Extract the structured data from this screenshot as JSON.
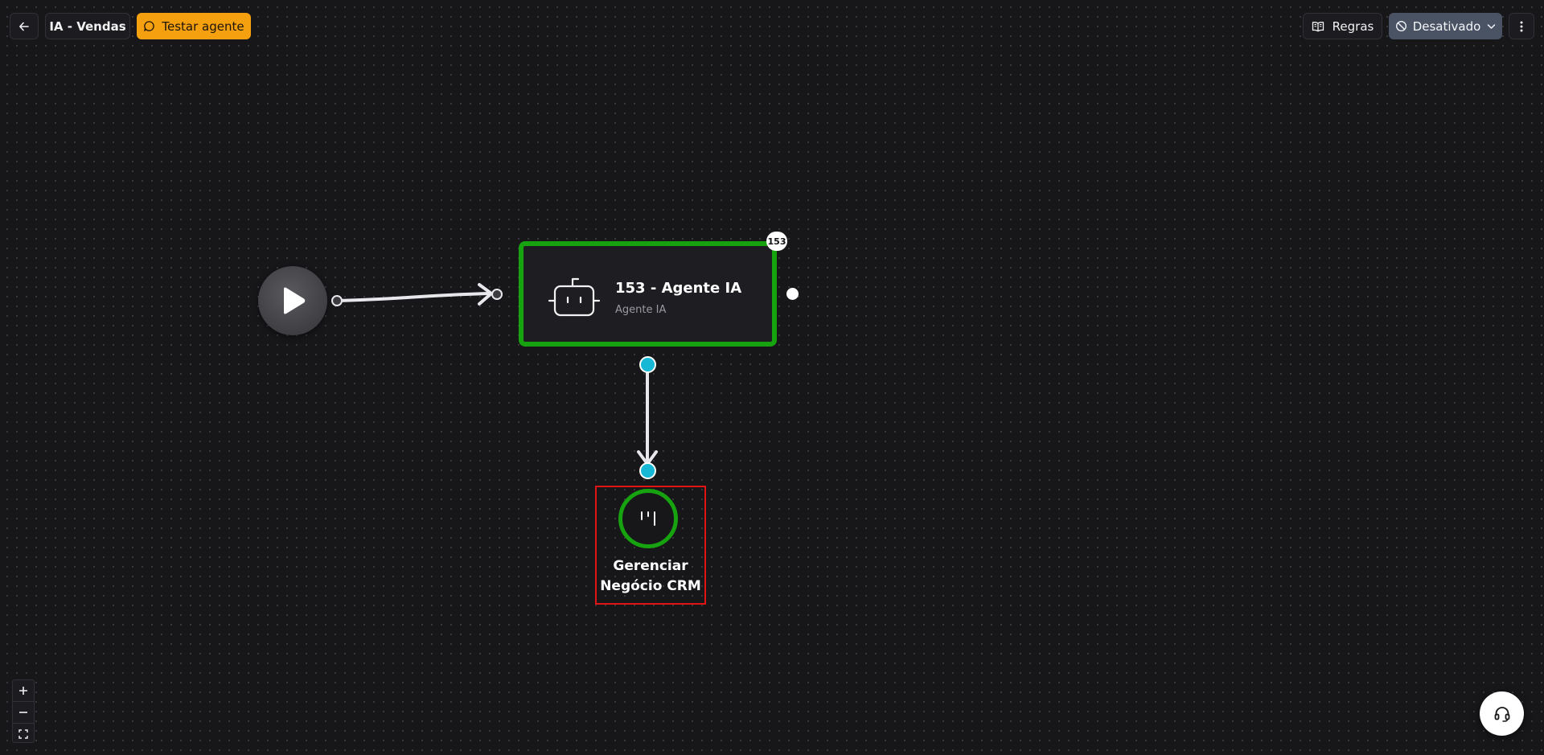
{
  "header": {
    "flow_title": "IA - Vendas",
    "test_agent_label": "Testar agente",
    "rules_label": "Regras",
    "status_label": "Desativado",
    "back_icon": "arrow-left-icon",
    "more_icon": "more-vertical-icon"
  },
  "nodes": {
    "start": {
      "icon": "play-icon"
    },
    "agent": {
      "title": "153 - Agente IA",
      "subtitle": "Agente IA",
      "badge": "153",
      "icon": "robot-icon"
    },
    "crm": {
      "label": "Gerenciar Negócio CRM",
      "icon": "kanban-icon"
    }
  },
  "controls": {
    "zoom_in": "+",
    "zoom_out": "—",
    "fit": "fit-view-icon"
  },
  "colors": {
    "accent_orange": "#f5a00f",
    "status_bg": "#4a5364",
    "node_green": "#17a20f",
    "handle_cyan": "#17b8d6",
    "selection_red": "#e01414"
  }
}
